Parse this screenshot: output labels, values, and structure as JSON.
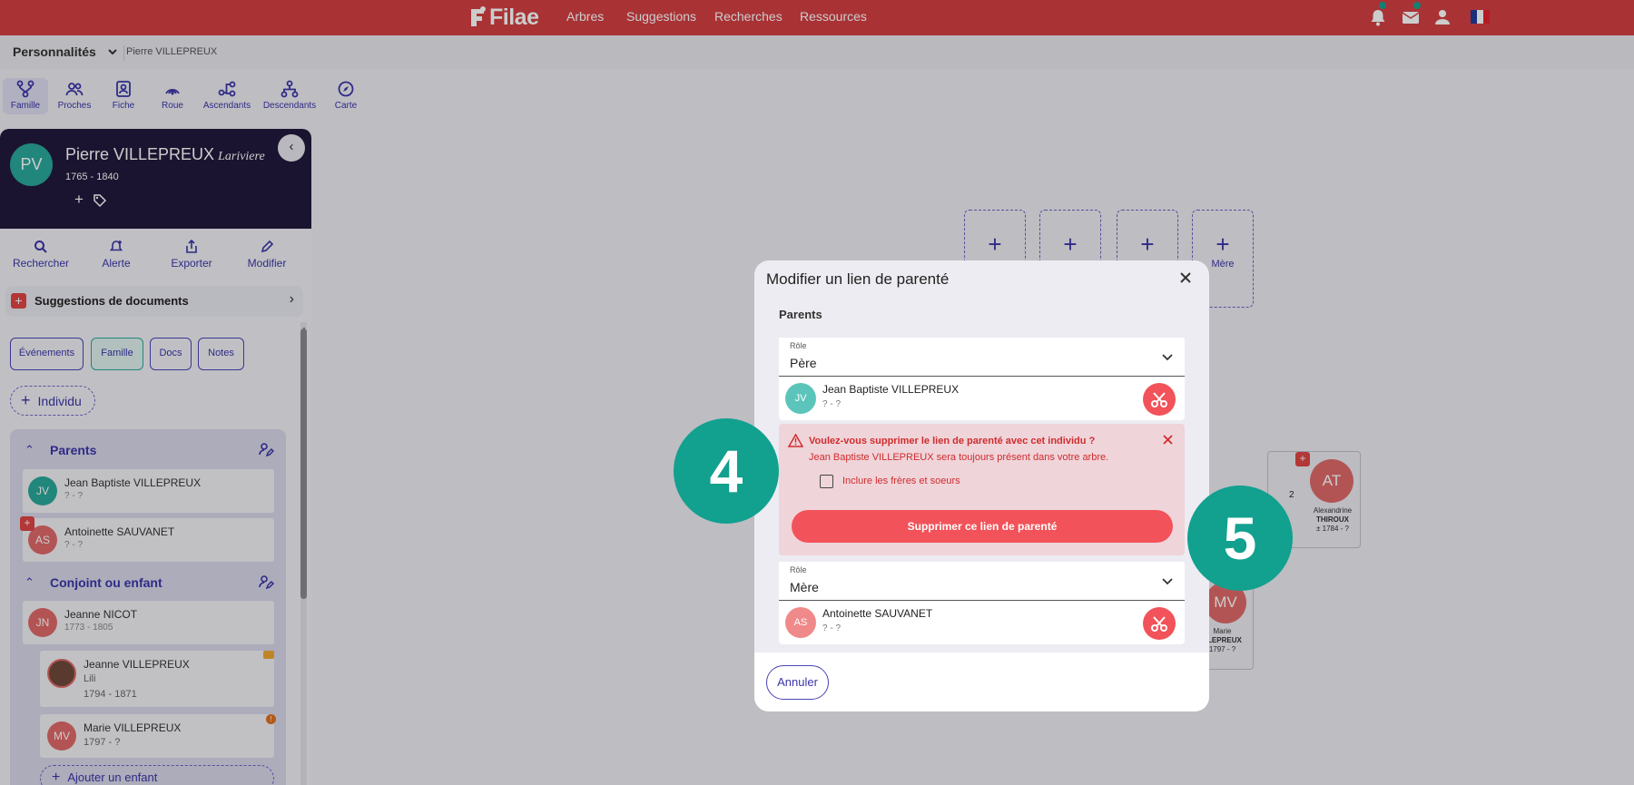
{
  "topbar": {
    "logo": "Filae",
    "nav": [
      "Arbres",
      "Suggestions",
      "Recherches",
      "Ressources"
    ]
  },
  "breadcrumb": {
    "selector": "Personnalités",
    "current": "Pierre VILLEPREUX"
  },
  "view_tabs": [
    "Famille",
    "Proches",
    "Fiche",
    "Roue",
    "Ascendants",
    "Descendants",
    "Carte"
  ],
  "person": {
    "initials": "PV",
    "name": "Pierre VILLEPREUX",
    "nickname": "Lariviere",
    "dates": "1765 - 1840"
  },
  "actions": [
    "Rechercher",
    "Alerte",
    "Exporter",
    "Modifier"
  ],
  "suggestions_label": "Suggestions de documents",
  "tabs": [
    "Événements",
    "Famille",
    "Docs",
    "Notes"
  ],
  "add_individual": "Individu",
  "sidebar": {
    "parents_title": "Parents",
    "parents": [
      {
        "initials": "JV",
        "name": "Jean Baptiste VILLEPREUX",
        "dates": "? - ?"
      },
      {
        "initials": "AS",
        "name": "Antoinette SAUVANET",
        "dates": "? - ?"
      }
    ],
    "spouse_title": "Conjoint ou enfant",
    "spouse": {
      "initials": "JN",
      "name": "Jeanne NICOT",
      "dates": "1773 - 1805"
    },
    "children": [
      {
        "name": "Jeanne VILLEPREUX",
        "nickname": "Lili",
        "dates": "1794 - 1871"
      },
      {
        "initials": "MV",
        "name": "Marie VILLEPREUX",
        "dates": "1797 - ?"
      }
    ],
    "add_child": "Ajouter un enfant"
  },
  "canvas": {
    "add_mother": "Mère",
    "at_initials": "AT",
    "at_name_1": "Alexandrine",
    "at_name_2": "THIROUX",
    "at_dates": "± 1784 - ?",
    "at_count": "2",
    "mv_initials": "MV",
    "mv_name_1": "Marie",
    "mv_name_2": "LLEPREUX",
    "mv_dates": "1797 - ?"
  },
  "modal": {
    "title": "Modifier un lien de parenté",
    "section": "Parents",
    "role_label": "Rôle",
    "father_role": "Père",
    "father": {
      "initials": "JV",
      "name": "Jean Baptiste VILLEPREUX",
      "dates": "? - ?"
    },
    "warning_title": "Voulez-vous supprimer le lien de parenté avec cet individu ?",
    "warning_text": "Jean Baptiste VILLEPREUX sera toujours présent dans votre arbre.",
    "checkbox_label": "Inclure les frères et soeurs",
    "delete_button": "Supprimer ce lien de parenté",
    "mother_role": "Mère",
    "mother": {
      "initials": "AS",
      "name": "Antoinette SAUVANET",
      "dates": "? - ?"
    },
    "cancel": "Annuler"
  },
  "steps": [
    "4",
    "5"
  ],
  "colors": {
    "brand": "#d43f43",
    "accent": "#3b35a8",
    "danger": "#f25259",
    "teal": "#12a08f",
    "dark_panel": "#221a3c"
  }
}
